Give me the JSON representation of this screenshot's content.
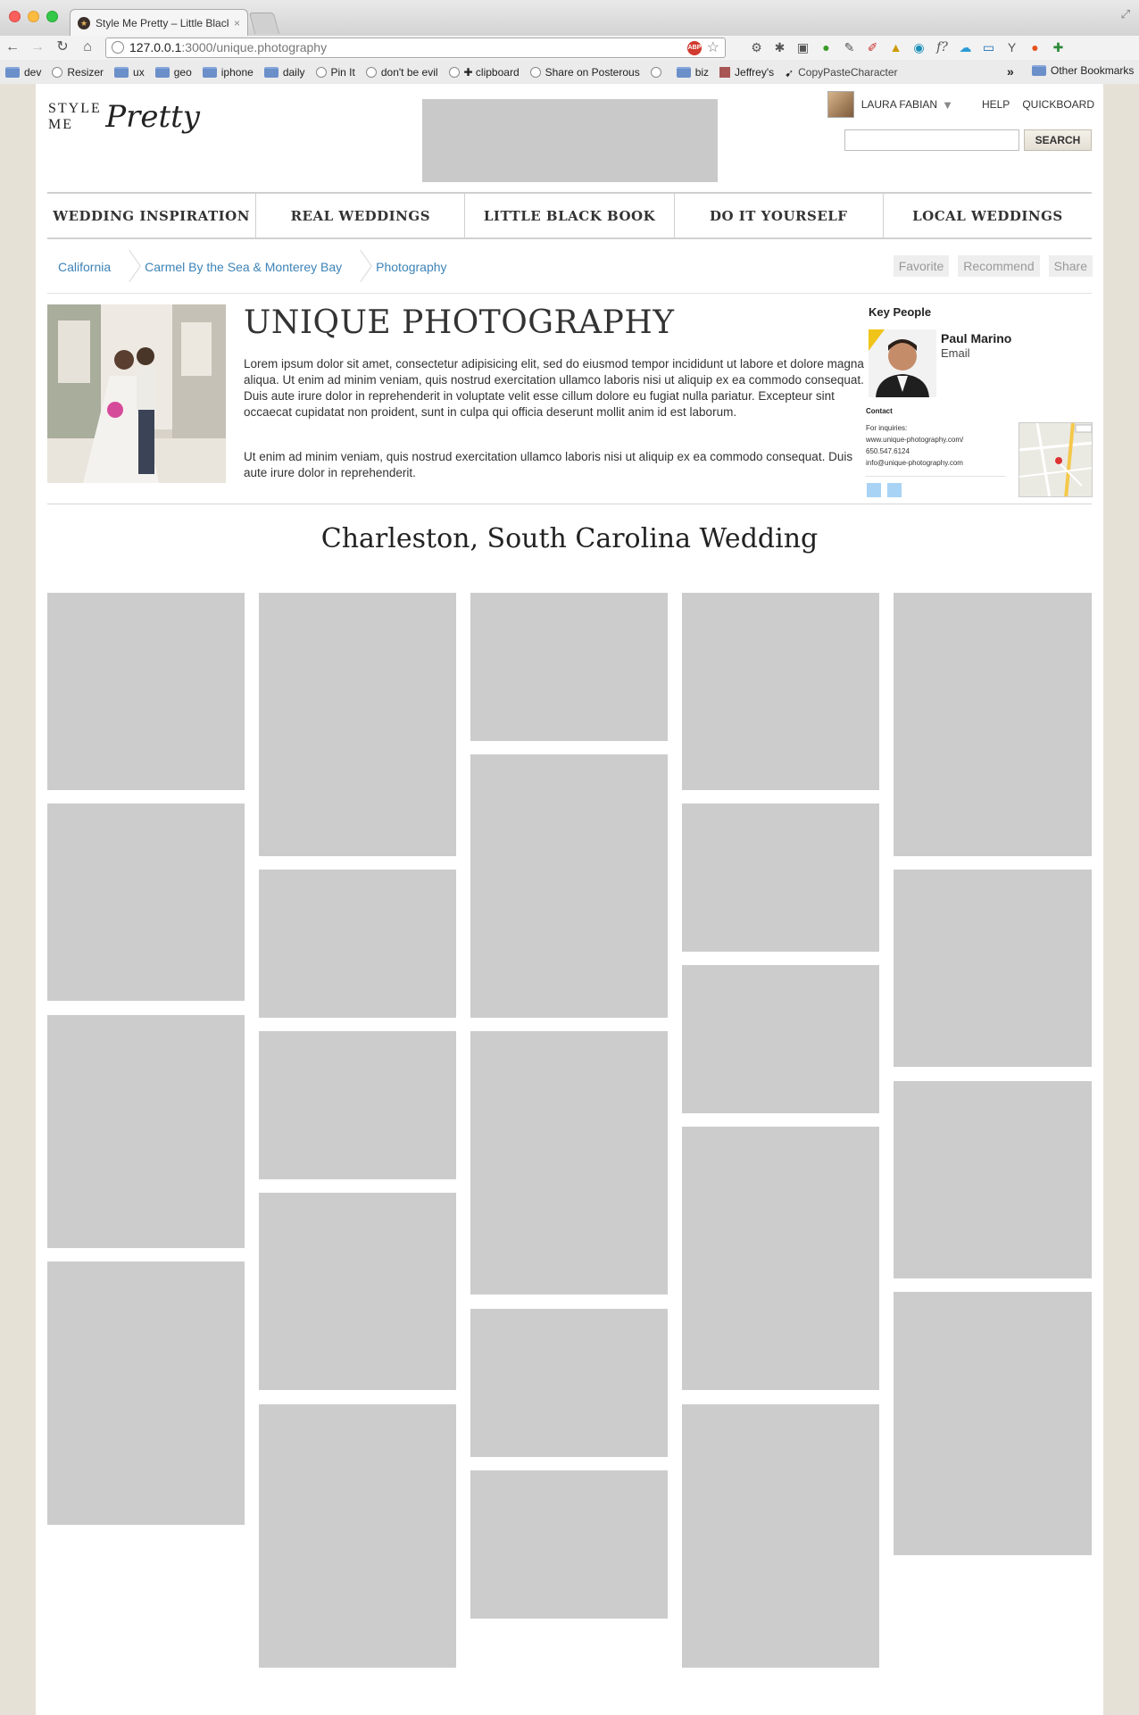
{
  "browser": {
    "tab_title": "Style Me Pretty – Little Black",
    "tab_close": "×",
    "url_host": "127.0.0.1",
    "url_path": ":3000/unique.photography",
    "adblock_label": "ABP",
    "bookmarks": [
      "dev",
      "Resizer",
      "ux",
      "geo",
      "iphone",
      "daily",
      "Pin It",
      "don't be evil",
      "✚ clipboard",
      "Share on Posterous",
      "",
      "biz",
      "Jeffrey's",
      "CopyPasteCharacter"
    ],
    "more": "»",
    "other_bookmarks": "Other Bookmarks"
  },
  "header": {
    "logo_prefix": "STYLE ME",
    "logo_script": "Pretty",
    "user_name": "LAURA FABIAN",
    "help": "HELP",
    "quickboard": "QUICKBOARD",
    "search_button": "SEARCH",
    "search_value": ""
  },
  "nav": {
    "items": [
      "WEDDING INSPIRATION",
      "REAL WEDDINGS",
      "LITTLE BLACK BOOK",
      "DO IT YOURSELF",
      "LOCAL WEDDINGS"
    ]
  },
  "breadcrumb": [
    "California",
    "Carmel By the Sea & Monterey Bay",
    "Photography"
  ],
  "actions": [
    "Favorite",
    "Recommend",
    "Share"
  ],
  "vendor": {
    "title": "UNIQUE PHOTOGRAPHY",
    "paragraph1": "Lorem ipsum dolor sit amet, consectetur adipisicing elit, sed do eiusmod tempor incididunt ut labore et dolore magna aliqua. Ut enim ad minim veniam, quis nostrud exercitation ullamco laboris nisi ut aliquip ex ea commodo consequat. Duis aute irure dolor in reprehenderit in voluptate velit esse cillum dolore eu fugiat nulla pariatur. Excepteur sint occaecat cupidatat non proident, sunt in culpa qui officia deserunt mollit anim id est laborum.",
    "paragraph2": "Ut enim ad minim veniam, quis nostrud exercitation ullamco laboris nisi ut aliquip ex ea commodo consequat. Duis aute irure dolor in reprehenderit."
  },
  "key_people": {
    "heading": "Key People",
    "name": "Paul Marino",
    "email_label": "Email",
    "contact_heading": "Contact",
    "contact_lines": [
      "For inquiries:",
      "www.unique-photography.com/",
      "650.547.6124",
      "info@unique-photography.com"
    ]
  },
  "gallery": {
    "title": "Charleston, South Carolina Wedding"
  }
}
